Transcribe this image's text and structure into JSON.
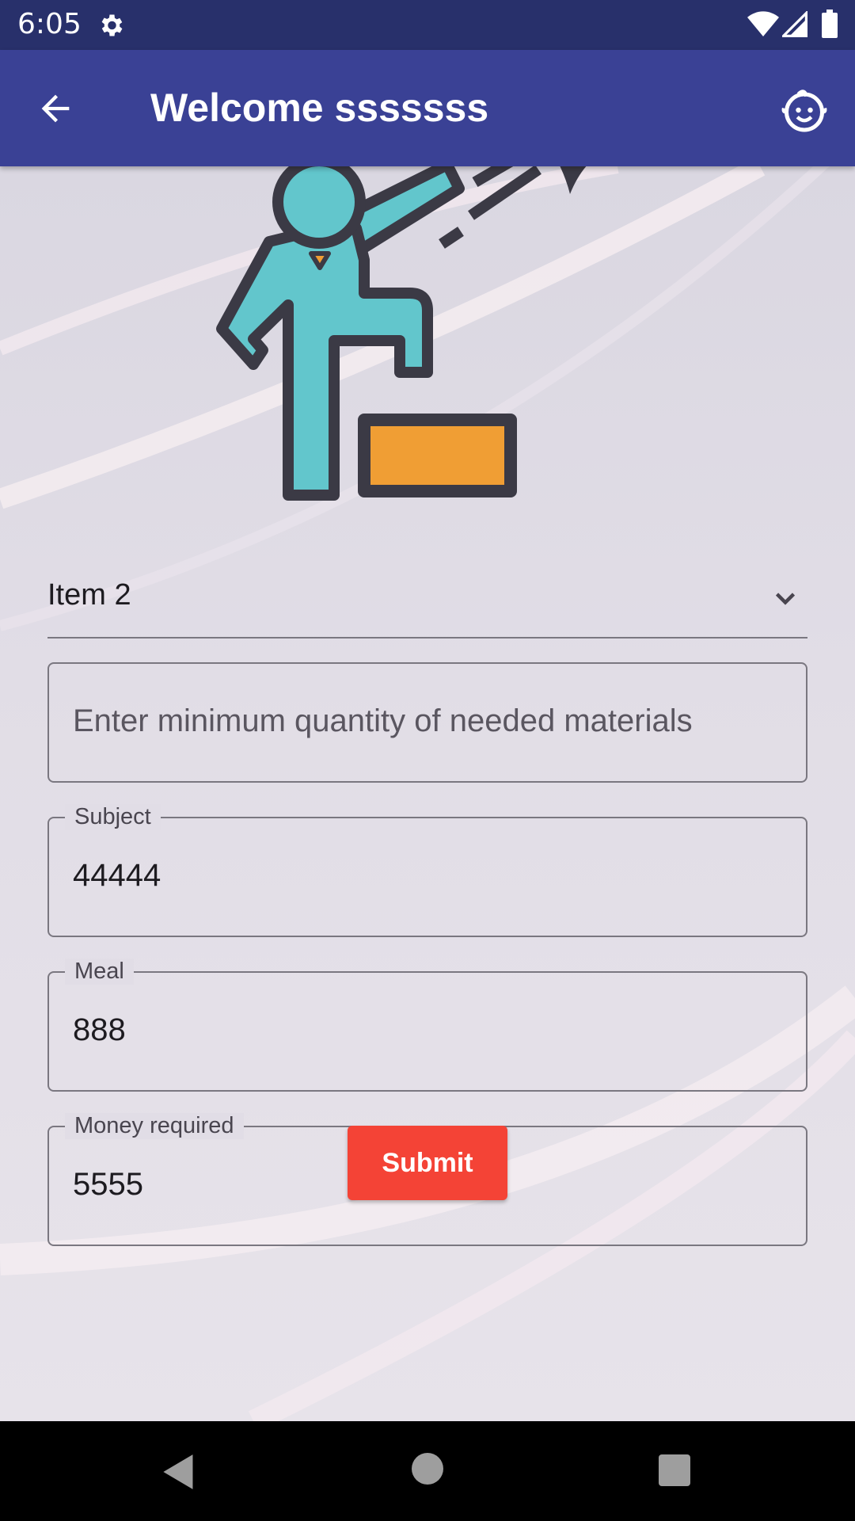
{
  "status_bar": {
    "time": "6:05",
    "icons": [
      "gear-icon",
      "wifi-icon",
      "signal-icon",
      "battery-icon"
    ]
  },
  "app_bar": {
    "title": "Welcome sssssss",
    "back_icon": "arrow-back-icon",
    "action_icon": "child-face-icon",
    "background": "#3a4195"
  },
  "form": {
    "dropdown": {
      "selected": "Item 2"
    },
    "min_quantity": {
      "placeholder": "Enter minimum quantity of needed materials",
      "value": ""
    },
    "subject": {
      "label": "Subject",
      "value": "44444"
    },
    "meal": {
      "label": "Meal",
      "value": "888"
    },
    "money": {
      "label": "Money required",
      "value": "5555"
    },
    "submit_label": "Submit",
    "submit_color": "#f44336"
  },
  "nav_bar": {
    "icons": [
      "nav-back-icon",
      "nav-home-icon",
      "nav-recents-icon"
    ]
  }
}
